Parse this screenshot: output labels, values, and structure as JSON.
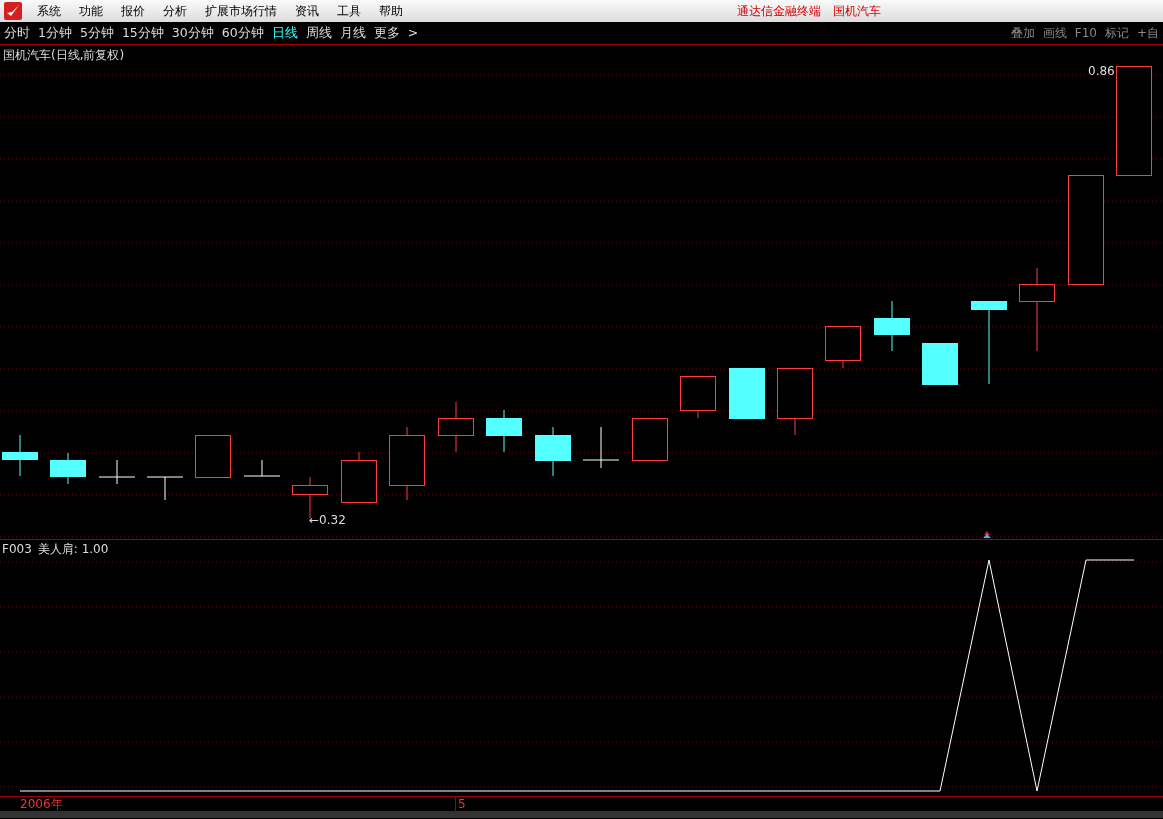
{
  "menu": {
    "items": [
      "系统",
      "功能",
      "报价",
      "分析",
      "扩展市场行情",
      "资讯",
      "工具",
      "帮助"
    ]
  },
  "title_bar": {
    "product": "通达信金融终端",
    "stock": "国机汽车"
  },
  "periods": [
    {
      "label": "分时",
      "selected": false
    },
    {
      "label": "1分钟",
      "selected": false
    },
    {
      "label": "5分钟",
      "selected": false
    },
    {
      "label": "15分钟",
      "selected": false
    },
    {
      "label": "30分钟",
      "selected": false
    },
    {
      "label": "60分钟",
      "selected": false
    },
    {
      "label": "日线",
      "selected": true
    },
    {
      "label": "周线",
      "selected": false
    },
    {
      "label": "月线",
      "selected": false
    },
    {
      "label": "更多",
      "selected": false
    }
  ],
  "more_arrow": ">",
  "toolbar_right": [
    "叠加",
    "画线",
    "F10",
    "标记",
    "+自"
  ],
  "main_chart": {
    "title": "国机汽车(日线,前复权)",
    "low_label": "←0.32",
    "high_label": "0.86"
  },
  "indicator": {
    "name": "F003",
    "label": "美人肩: 1.00"
  },
  "date_axis": [
    "2006年",
    "5"
  ]
}
